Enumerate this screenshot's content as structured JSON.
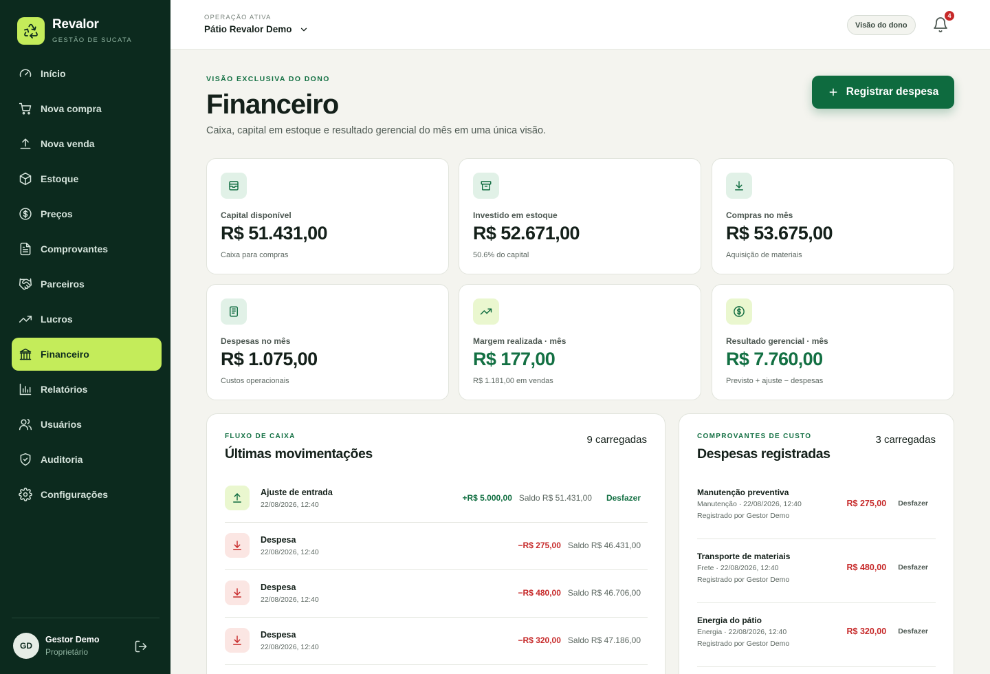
{
  "brand": {
    "name": "Revalor",
    "subtitle": "GESTÃO DE SUCATA"
  },
  "sidebar": {
    "items": [
      {
        "label": "Início",
        "icon": "gauge-icon"
      },
      {
        "label": "Nova compra",
        "icon": "cart-icon"
      },
      {
        "label": "Nova venda",
        "icon": "upload-icon"
      },
      {
        "label": "Estoque",
        "icon": "box-icon"
      },
      {
        "label": "Preços",
        "icon": "dollar-circle-icon"
      },
      {
        "label": "Comprovantes",
        "icon": "document-icon"
      },
      {
        "label": "Parceiros",
        "icon": "handshake-icon"
      },
      {
        "label": "Lucros",
        "icon": "trending-up-icon"
      },
      {
        "label": "Financeiro",
        "icon": "bank-icon",
        "active": true
      },
      {
        "label": "Relatórios",
        "icon": "bar-chart-icon"
      },
      {
        "label": "Usuários",
        "icon": "users-icon"
      },
      {
        "label": "Auditoria",
        "icon": "shield-icon"
      },
      {
        "label": "Configurações",
        "icon": "gear-icon"
      }
    ],
    "user": {
      "initials": "GD",
      "name": "Gestor Demo",
      "role": "Proprietário"
    }
  },
  "topbar": {
    "operation_label": "OPERAÇÃO ATIVA",
    "operation_name": "Pátio Revalor Demo",
    "owner_view": "Visão do dono",
    "notifications": "4"
  },
  "header": {
    "eyebrow": "VISÃO EXCLUSIVA DO DONO",
    "title": "Financeiro",
    "subtitle": "Caixa, capital em estoque e resultado gerencial do mês em uma única visão.",
    "cta": "Registrar despesa"
  },
  "cards": [
    {
      "label": "Capital disponível",
      "value": "R$ 51.431,00",
      "note": "Caixa para compras",
      "icon": "wallet-icon"
    },
    {
      "label": "Investido em estoque",
      "value": "R$ 52.671,00",
      "note": "50.6% do capital",
      "icon": "archive-icon"
    },
    {
      "label": "Compras no mês",
      "value": "R$ 53.675,00",
      "note": "Aquisição de materiais",
      "icon": "download-icon"
    },
    {
      "label": "Despesas no mês",
      "value": "R$ 1.075,00",
      "note": "Custos operacionais",
      "icon": "receipt-icon"
    },
    {
      "label": "Margem realizada · mês",
      "value": "R$ 177,00",
      "note": "R$ 1.181,00 em vendas",
      "icon": "trending-up-icon"
    },
    {
      "label": "Resultado gerencial · mês",
      "value": "R$ 7.760,00",
      "note": "Previsto + ajuste − despesas",
      "icon": "dollar-circle-icon"
    }
  ],
  "cashflow": {
    "eyebrow": "FLUXO DE CAIXA",
    "title": "Últimas movimentações",
    "count": "9 carregadas",
    "rows": [
      {
        "title": "Ajuste de entrada",
        "date": "22/08/2026, 12:40",
        "amount": "+R$ 5.000,00",
        "balance": "Saldo R$ 51.431,00",
        "action": "Desfazer"
      },
      {
        "title": "Despesa",
        "date": "22/08/2026, 12:40",
        "amount": "−R$ 275,00",
        "balance": "Saldo R$ 46.431,00"
      },
      {
        "title": "Despesa",
        "date": "22/08/2026, 12:40",
        "amount": "−R$ 480,00",
        "balance": "Saldo R$ 46.706,00"
      },
      {
        "title": "Despesa",
        "date": "22/08/2026, 12:40",
        "amount": "−R$ 320,00",
        "balance": "Saldo R$ 47.186,00"
      }
    ]
  },
  "expenses": {
    "eyebrow": "COMPROVANTES DE CUSTO",
    "title": "Despesas registradas",
    "count": "3 carregadas",
    "rows": [
      {
        "title": "Manutenção preventiva",
        "meta": "Manutenção · 22/08/2026, 12:40",
        "by": "Registrado por Gestor Demo",
        "amount": "R$ 275,00",
        "action": "Desfazer"
      },
      {
        "title": "Transporte de materiais",
        "meta": "Frete · 22/08/2026, 12:40",
        "by": "Registrado por Gestor Demo",
        "amount": "R$ 480,00",
        "action": "Desfazer"
      },
      {
        "title": "Energia do pátio",
        "meta": "Energia · 22/08/2026, 12:40",
        "by": "Registrado por Gestor Demo",
        "amount": "R$ 320,00",
        "action": "Desfazer"
      }
    ]
  },
  "colors": {
    "sidebar_bg": "#0c2a1e",
    "accent_lime": "#c4ec5a",
    "primary_green": "#0e6b3f",
    "negative_red": "#c62828",
    "page_bg": "#f4f4ef"
  }
}
